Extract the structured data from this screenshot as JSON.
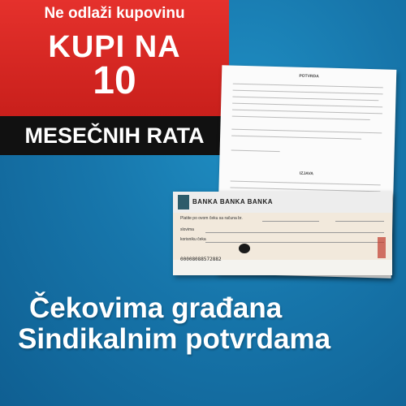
{
  "promo": {
    "line1": "Ne odlaži kupovinu",
    "line2": "KUPI NA",
    "number": "10",
    "bar": "MESEČNIH RATA"
  },
  "document": {
    "title": "POTVRDA",
    "subtitle": "IZJAVA"
  },
  "check": {
    "bank": "BANKA BANKA BANKA",
    "pay_line": "Platite po ovom čeku sa računa br.",
    "amount_words": "slovima",
    "holder": "korisniku čeka",
    "code": "00008088572882"
  },
  "headline": {
    "line1": "Čekovima građana",
    "line2": "Sindikalnim potvrdama"
  },
  "colors": {
    "background": "#1776ab",
    "promo_red": "#d9261f",
    "bar_black": "#111111"
  }
}
